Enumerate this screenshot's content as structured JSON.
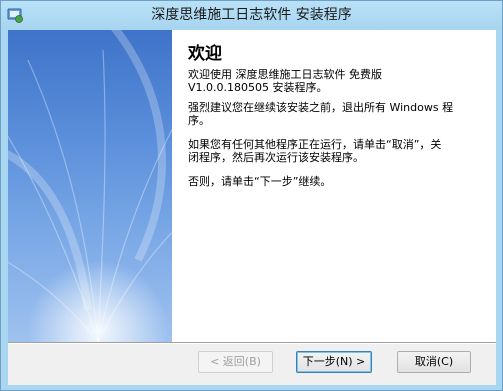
{
  "window": {
    "title": "深度思维施工日志软件 安装程序",
    "icon": "installer-icon"
  },
  "welcome": {
    "heading": "欢迎",
    "paragraphs": [
      "欢迎使用 深度思维施工日志软件 免费版\nV1.0.0.180505 安装程序。",
      "强烈建议您在继续该安装之前，退出所有 Windows 程\n序。",
      "如果您有任何其他程序正在运行，请单击“取消”，关\n闭程序，然后再次运行该安装程序。",
      "否则，请单击“下一步”继续。"
    ]
  },
  "buttons": {
    "back": "< 返回(B)",
    "next": "下一步(N) >",
    "cancel": "取消(C)"
  },
  "colors": {
    "title_bar": "#a9d6f1",
    "side_panel_top": "#3e73c9",
    "side_panel_bottom": "#9fc2ef"
  }
}
